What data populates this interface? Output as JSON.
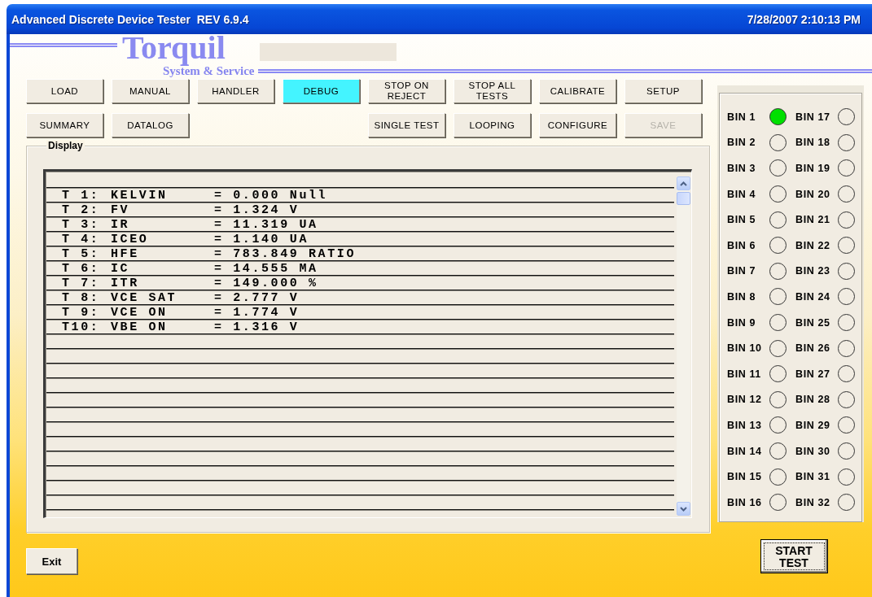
{
  "window": {
    "title": "Advanced Discrete Device Tester  REV 6.9.4",
    "datetime": "7/28/2007 2:10:13 PM"
  },
  "logo": {
    "name": "Torquil",
    "tagline": "System & Service"
  },
  "toolbar": [
    {
      "left": [
        {
          "label": "LOAD",
          "selected": false,
          "disabled": false
        },
        {
          "label": "MANUAL",
          "selected": false,
          "disabled": false
        },
        {
          "label": "HANDLER",
          "selected": false,
          "disabled": false
        },
        {
          "label": "DEBUG",
          "selected": true,
          "disabled": false
        },
        {
          "label": "STOP ON\nREJECT",
          "selected": false,
          "disabled": false
        },
        {
          "label": "STOP ALL\nTESTS",
          "selected": false,
          "disabled": false
        },
        {
          "label": "CALIBRATE",
          "selected": false,
          "disabled": false
        },
        {
          "label": "SETUP",
          "selected": false,
          "disabled": false
        }
      ]
    },
    {
      "left": [
        {
          "label": "SUMMARY",
          "selected": false,
          "disabled": false
        },
        {
          "label": "DATALOG",
          "selected": false,
          "disabled": false
        }
      ],
      "right": [
        {
          "label": "SINGLE TEST",
          "selected": false,
          "disabled": false
        },
        {
          "label": "LOOPING",
          "selected": false,
          "disabled": false
        },
        {
          "label": "CONFIGURE",
          "selected": false,
          "disabled": false
        },
        {
          "label": "SAVE",
          "selected": false,
          "disabled": true
        }
      ]
    }
  ],
  "display": {
    "label": "Display",
    "rows": [
      {
        "test": "T 1:",
        "name": "KELVIN",
        "result": "= 0.000 Null"
      },
      {
        "test": "T 2:",
        "name": "FV",
        "result": "= 1.324 V"
      },
      {
        "test": "T 3:",
        "name": "IR",
        "result": "= 11.319 UA"
      },
      {
        "test": "T 4:",
        "name": "ICEO",
        "result": "= 1.140 UA"
      },
      {
        "test": "T 5:",
        "name": "HFE",
        "result": "= 783.849 RATIO"
      },
      {
        "test": "T 6:",
        "name": "IC",
        "result": "= 14.555 MA"
      },
      {
        "test": "T 7:",
        "name": "ITR",
        "result": "= 149.000 %"
      },
      {
        "test": "T 8:",
        "name": "VCE SAT",
        "result": "= 2.777 V"
      },
      {
        "test": "T 9:",
        "name": "VCE ON",
        "result": "= 1.774 V"
      },
      {
        "test": "T10:",
        "name": "VBE ON",
        "result": "= 1.316 V"
      }
    ]
  },
  "bins": [
    {
      "label": "BIN 1",
      "lit": true
    },
    {
      "label": "BIN 2",
      "lit": false
    },
    {
      "label": "BIN 3",
      "lit": false
    },
    {
      "label": "BIN 4",
      "lit": false
    },
    {
      "label": "BIN 5",
      "lit": false
    },
    {
      "label": "BIN 6",
      "lit": false
    },
    {
      "label": "BIN 7",
      "lit": false
    },
    {
      "label": "BIN 8",
      "lit": false
    },
    {
      "label": "BIN 9",
      "lit": false
    },
    {
      "label": "BIN 10",
      "lit": false
    },
    {
      "label": "BIN 11",
      "lit": false
    },
    {
      "label": "BIN 12",
      "lit": false
    },
    {
      "label": "BIN 13",
      "lit": false
    },
    {
      "label": "BIN 14",
      "lit": false
    },
    {
      "label": "BIN 15",
      "lit": false
    },
    {
      "label": "BIN 16",
      "lit": false
    },
    {
      "label": "BIN 17",
      "lit": false
    },
    {
      "label": "BIN 18",
      "lit": false
    },
    {
      "label": "BIN 19",
      "lit": false
    },
    {
      "label": "BIN 20",
      "lit": false
    },
    {
      "label": "BIN 21",
      "lit": false
    },
    {
      "label": "BIN 22",
      "lit": false
    },
    {
      "label": "BIN 23",
      "lit": false
    },
    {
      "label": "BIN 24",
      "lit": false
    },
    {
      "label": "BIN 25",
      "lit": false
    },
    {
      "label": "BIN 26",
      "lit": false
    },
    {
      "label": "BIN 27",
      "lit": false
    },
    {
      "label": "BIN 28",
      "lit": false
    },
    {
      "label": "BIN 29",
      "lit": false
    },
    {
      "label": "BIN 30",
      "lit": false
    },
    {
      "label": "BIN 31",
      "lit": false
    },
    {
      "label": "BIN 32",
      "lit": false
    }
  ],
  "buttons": {
    "exit": "Exit",
    "start": "START\nTEST"
  }
}
